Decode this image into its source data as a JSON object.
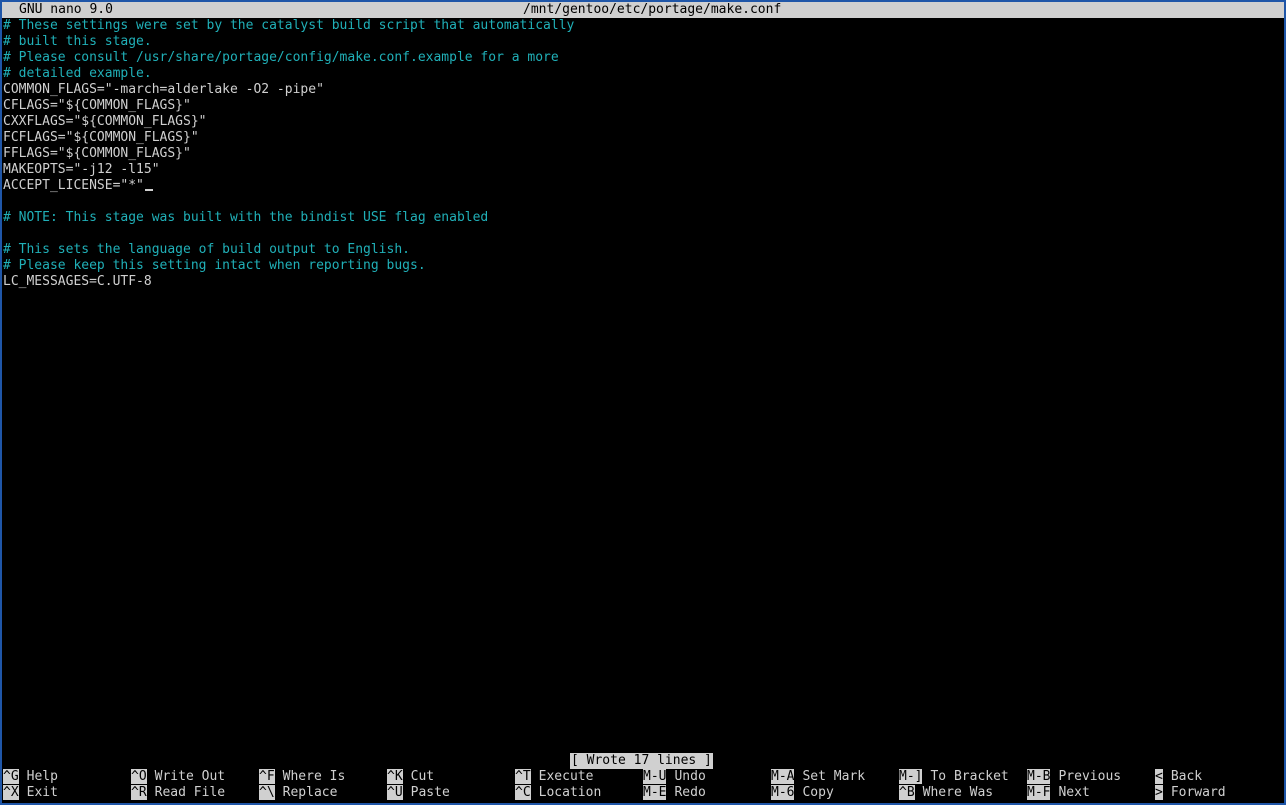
{
  "titlebar": {
    "app": "GNU nano 9.0",
    "file": "/mnt/gentoo/etc/portage/make.conf"
  },
  "editor": {
    "lines": [
      {
        "text": "# These settings were set by the catalyst build script that automatically",
        "kind": "comment"
      },
      {
        "text": "# built this stage.",
        "kind": "comment"
      },
      {
        "text": "# Please consult /usr/share/portage/config/make.conf.example for a more",
        "kind": "comment"
      },
      {
        "text": "# detailed example.",
        "kind": "comment"
      },
      {
        "text": "COMMON_FLAGS=\"-march=alderlake -O2 -pipe\"",
        "kind": "code"
      },
      {
        "text": "CFLAGS=\"${COMMON_FLAGS}\"",
        "kind": "code"
      },
      {
        "text": "CXXFLAGS=\"${COMMON_FLAGS}\"",
        "kind": "code"
      },
      {
        "text": "FCFLAGS=\"${COMMON_FLAGS}\"",
        "kind": "code"
      },
      {
        "text": "FFLAGS=\"${COMMON_FLAGS}\"",
        "kind": "code"
      },
      {
        "text": "MAKEOPTS=\"-j12 -l15\"",
        "kind": "code"
      },
      {
        "text": "ACCEPT_LICENSE=\"*\"",
        "kind": "code"
      },
      {
        "text": "",
        "kind": "code"
      },
      {
        "text": "# NOTE: This stage was built with the bindist USE flag enabled",
        "kind": "comment"
      },
      {
        "text": "",
        "kind": "code"
      },
      {
        "text": "# This sets the language of build output to English.",
        "kind": "comment"
      },
      {
        "text": "# Please keep this setting intact when reporting bugs.",
        "kind": "comment"
      },
      {
        "text": "LC_MESSAGES=C.UTF-8",
        "kind": "code"
      }
    ]
  },
  "status": "[ Wrote 17 lines ]",
  "shortcuts": {
    "row1": [
      {
        "key": "^G",
        "label": "Help"
      },
      {
        "key": "^O",
        "label": "Write Out"
      },
      {
        "key": "^F",
        "label": "Where Is"
      },
      {
        "key": "^K",
        "label": "Cut"
      },
      {
        "key": "^T",
        "label": "Execute"
      },
      {
        "key": "M-U",
        "label": "Undo"
      },
      {
        "key": "M-A",
        "label": "Set Mark"
      },
      {
        "key": "M-]",
        "label": "To Bracket"
      },
      {
        "key": "M-B",
        "label": "Previous"
      },
      {
        "key": "<",
        "label": "Back"
      }
    ],
    "row2": [
      {
        "key": "^X",
        "label": "Exit"
      },
      {
        "key": "^R",
        "label": "Read File"
      },
      {
        "key": "^\\",
        "label": "Replace"
      },
      {
        "key": "^U",
        "label": "Paste"
      },
      {
        "key": "^C",
        "label": "Location"
      },
      {
        "key": "M-E",
        "label": "Redo"
      },
      {
        "key": "M-6",
        "label": "Copy"
      },
      {
        "key": "^B",
        "label": "Where Was"
      },
      {
        "key": "M-F",
        "label": "Next"
      },
      {
        "key": ">",
        "label": "Forward"
      }
    ]
  }
}
